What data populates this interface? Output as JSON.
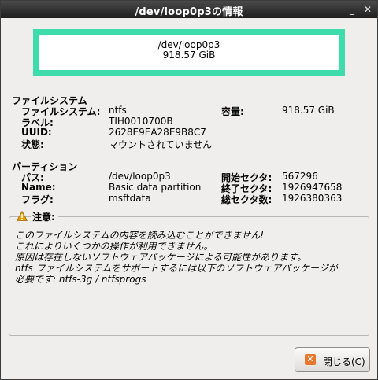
{
  "window": {
    "title": "/dev/loop0p3の情報"
  },
  "titlebar_buttons": {
    "minimize": "_",
    "close": "✕"
  },
  "device_panel": {
    "path": "/dev/loop0p3",
    "size": "918.57 GiB"
  },
  "filesystem": {
    "heading": "ファイルシステム",
    "fs_label": "ファイルシステム:",
    "fs_value": "ntfs",
    "label_label": "ラベル:",
    "label_value": "TIH0010700B",
    "uuid_label": "UUID:",
    "uuid_value": "2628E9EA28E9B8C7",
    "state_label": "状態:",
    "state_value": "マウントされていません",
    "capacity_label": "容量:",
    "capacity_value": "918.57 GiB"
  },
  "partition": {
    "heading": "パーティション",
    "path_label": "パス:",
    "path_value": "/dev/loop0p3",
    "name_label": "Name:",
    "name_value": "Basic data partition",
    "flags_label": "フラグ:",
    "flags_value": "msftdata",
    "start_label": "開始セクタ:",
    "start_value": "567296",
    "end_label": "終了セクタ:",
    "end_value": "1926947658",
    "total_label": "総セクタ数:",
    "total_value": "1926380363"
  },
  "warning": {
    "title": "注意:",
    "lines": [
      "このファイルシステムの内容を読み込むことができません!",
      "これによりいくつかの操作が利用できません。",
      "原因は存在しないソフトウェアパッケージによる可能性があります。",
      "ntfs ファイルシステムをサポートするには以下のソフトウェアパッケージが",
      "必要です: ntfs-3g / ntfsprogs"
    ]
  },
  "close_button": {
    "icon": "✕",
    "label": "閉じる(C)"
  },
  "colors": {
    "panel_border": "#3fdcab",
    "warning_icon": "#e8a000",
    "close_icon": "#e8772e"
  }
}
